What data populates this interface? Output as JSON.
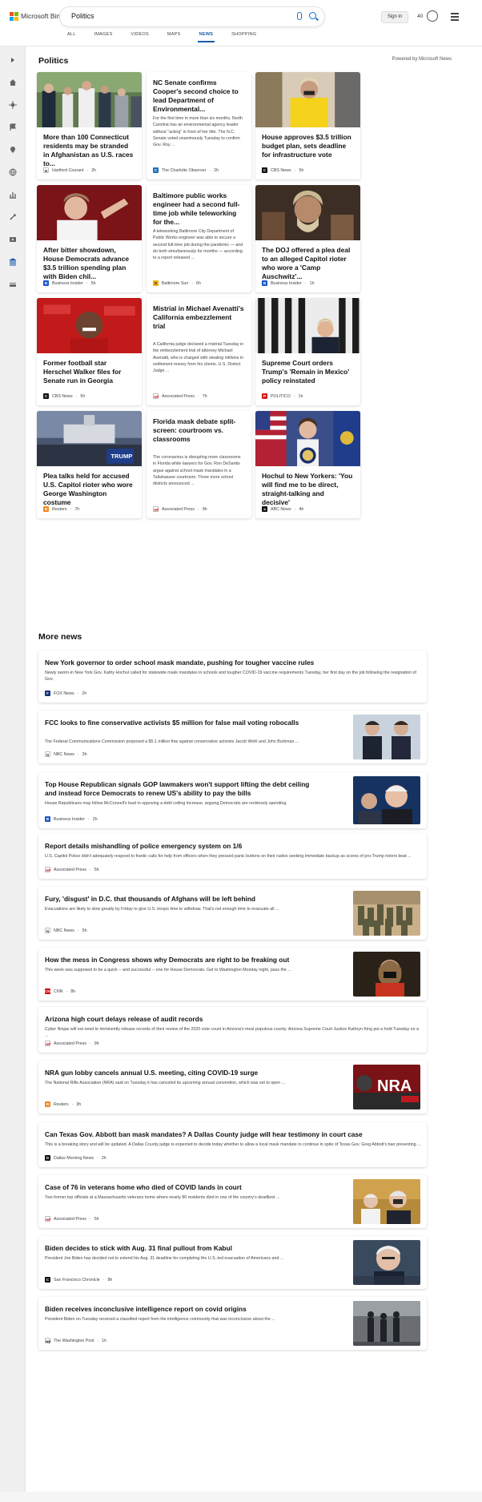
{
  "brand": {
    "name": "Microsoft Bing"
  },
  "search": {
    "query": "Politics"
  },
  "header": {
    "signin_label": "Sign in",
    "rewards_count": "40"
  },
  "tabs": [
    "ALL",
    "IMAGES",
    "VIDEOS",
    "MAPS",
    "NEWS",
    "SHOPPING"
  ],
  "active_tab": "NEWS",
  "colors": {
    "accent": "#1a5aa6",
    "search_icon": "#0d6fd1"
  },
  "section": {
    "title": "Politics",
    "powered_by": "Powered by Microsoft News"
  },
  "cards": [
    {
      "title": "More than 100 Connecticut residents may be stranded in Afghanistan as U.S. races to...",
      "source": "Hartford Courant",
      "time": "2h",
      "has_image": true
    },
    {
      "title": "NC Senate confirms Cooper's second choice to lead Department of Environmental...",
      "snippet": "For the first time in more than six months, North Carolina has an environmental agency leader without \"acting\" in front of her title. The N.C. Senate voted unanimously Tuesday to confirm Gov. Roy ...",
      "source": "The Charlotte Observer",
      "time": "2h",
      "has_image": false
    },
    {
      "title": "House approves $3.5 trillion budget plan, sets deadline for infrastructure vote",
      "source": "CBS News",
      "time": "5h",
      "has_image": true
    },
    {
      "title": "After bitter showdown, House Democrats advance $3.5 trillion spending plan with Biden chil...",
      "source": "Business Insider",
      "time": "5h",
      "has_image": true
    },
    {
      "title": "Baltimore public works engineer had a second full-time job while teleworking for the...",
      "snippet": "A teleworking Baltimore City Department of Public Works engineer was able to secure a second full-time job during the pandemic — and do both simultaneously for months — according to a report released ...",
      "source": "Baltimore Sun",
      "time": "6h",
      "has_image": false
    },
    {
      "title": "The DOJ offered a plea deal to an alleged Capitol rioter who wore a 'Camp Auschwitz'...",
      "source": "Business Insider",
      "time": "1h",
      "has_image": true
    },
    {
      "title": "Former football star Herschel Walker files for Senate run in Georgia",
      "source": "CBS News",
      "time": "5h",
      "has_image": true
    },
    {
      "title": "Mistrial in Michael Avenatti's California embezzlement trial",
      "snippet": "A California judge declared a mistrial Tuesday in the embezzlement trial of attorney Michael Avenatti, who is charged with stealing millions in settlement money from his clients. U.S. District Judge ...",
      "source": "Associated Press",
      "time": "7h",
      "has_image": false
    },
    {
      "title": "Supreme Court orders Trump's 'Remain in Mexico' policy reinstated",
      "source": "POLITICO",
      "time": "1h",
      "has_image": true
    },
    {
      "title": "Plea talks held for accused U.S. Capitol rioter who wore George Washington costume",
      "source": "Reuters",
      "time": "7h",
      "has_image": true
    },
    {
      "title": "Florida mask debate split-screen: courtroom vs. classrooms",
      "snippet": "The coronavirus is disrupting more classrooms in Florida while lawyers for Gov. Ron DeSantis argue against school mask mandates in a Tallahassee courtroom. Three more school districts announced ...",
      "source": "Associated Press",
      "time": "9h",
      "has_image": false
    },
    {
      "title": "Hochul to New Yorkers: 'You will find me to be direct, straight-talking and decisive'",
      "source": "ABC News",
      "time": "4h",
      "has_image": true
    }
  ],
  "more_news_title": "More news",
  "more_news": [
    {
      "title": "New York governor to order school mask mandate, pushing for tougher vaccine rules",
      "snippet": "Newly sworn-in New York Gov. Kathy Hochul called for statewide mask mandates in schools and tougher COVID-19 vaccine requirements Tuesday, her first day on the job following the resignation of Gov.",
      "source": "FOX News",
      "time": "2h",
      "has_image": false
    },
    {
      "title": "FCC looks to fine conservative activists $5 million for false mail voting robocalls",
      "snippet": "The Federal Communications Commission proposed a $5.1 million fine against conservative activists Jacob Wohl and John Burkman ...",
      "source": "NBC News",
      "time": "3h",
      "has_image": true
    },
    {
      "title": "Top House Republican signals GOP lawmakers won't support lifting the debt ceiling and instead force Democrats to renew US's ability to pay the bills",
      "snippet": "House Republicans may follow McConnell's lead in opposing a debt ceiling increase, arguing Democrats are recklessly spending.",
      "source": "Business Insider",
      "time": "2h",
      "has_image": true
    },
    {
      "title": "Report details mishandling of police emergency system on 1/6",
      "snippet": "U.S. Capitol Police didn't adequately respond to frantic calls for help from officers when they pressed panic buttons on their radios seeking immediate backup as scores of pro-Trump rioters beat ...",
      "source": "Associated Press",
      "time": "5h",
      "has_image": false
    },
    {
      "title": "Fury, 'disgust' in D.C. that thousands of Afghans will be left behind",
      "snippet": "Evacuations are likely to slow greatly by Friday to give U.S. troops time to withdraw. That's not enough time to evacuate all ...",
      "source": "NBC News",
      "time": "5h",
      "has_image": true
    },
    {
      "title": "How the mess in Congress shows why Democrats are right to be freaking out",
      "snippet": "This week was supposed to be a quick -- and successful -- one for House Democrats. Get to Washington Monday night, pass the ...",
      "source": "CNN",
      "time": "8h",
      "has_image": true
    },
    {
      "title": "Arizona high court delays release of audit records",
      "snippet": "Cyber Ninjas will not need to imminently release records of their review of the 2020 vote count in Arizona's most populous county. Arizona Supreme Court Justice Kathryn King put a hold Tuesday on a ...",
      "source": "Associated Press",
      "time": "9h",
      "has_image": false
    },
    {
      "title": "NRA gun lobby cancels annual U.S. meeting, citing COVID-19 surge",
      "snippet": "The National Rifle Association (NRA) said on Tuesday it has canceled its upcoming annual convention, which was set to open ...",
      "source": "Reuters",
      "time": "3h",
      "has_image": true,
      "thumb_text": "NRA"
    },
    {
      "title": "Can Texas Gov. Abbott ban mask mandates? A Dallas County judge will hear testimony in court case",
      "snippet": "This is a breaking story and will be updated. A Dallas County judge is expected to decide today whether to allow a local mask mandate to continue in spite of Texas Gov. Greg Abbott's ban preventing ...",
      "source": "Dallas Morning News",
      "time": "2h",
      "has_image": false
    },
    {
      "title": "Case of 76 in veterans home who died of COVID lands in court",
      "snippet": "Two former top officials at a Massachusetts veterans home where nearly 80 residents died in one of the country's deadliest ...",
      "source": "Associated Press",
      "time": "5h",
      "has_image": true
    },
    {
      "title": "Biden decides to stick with Aug. 31 final pullout from Kabul",
      "snippet": "President Joe Biden has decided not to extend his Aug. 31 deadline for completing the U.S.-led evacuation of Americans and ...",
      "source": "San Francisco Chronicle",
      "time": "8h",
      "has_image": true
    },
    {
      "title": "Biden receives inconclusive intelligence report on covid origins",
      "snippet": "President Biden on Tuesday received a classified report from the intelligence community that was inconclusive about the ...",
      "source": "The Washington Post",
      "time": "1h",
      "has_image": true
    }
  ]
}
